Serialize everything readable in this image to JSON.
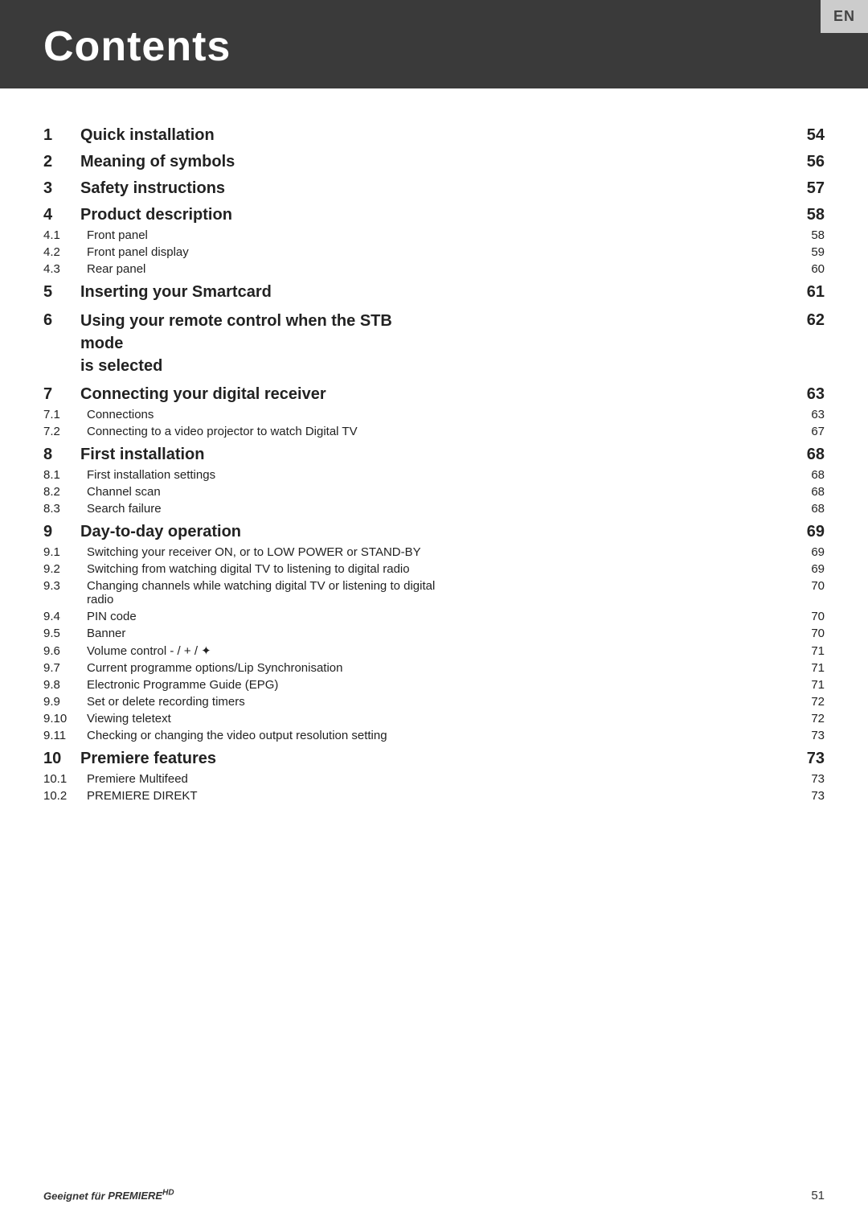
{
  "header": {
    "title": "Contents",
    "lang_tab": "EN"
  },
  "footer": {
    "brand_prefix": "Geeignet für",
    "brand_name": "PREMIEREHD",
    "page_number": "51"
  },
  "toc": {
    "entries": [
      {
        "id": "1",
        "number": "1",
        "label": "Quick installation",
        "page": "54",
        "level": "major"
      },
      {
        "id": "2",
        "number": "2",
        "label": "Meaning of symbols",
        "page": "56",
        "level": "major"
      },
      {
        "id": "3",
        "number": "3",
        "label": "Safety instructions",
        "page": "57",
        "level": "major"
      },
      {
        "id": "4",
        "number": "4",
        "label": "Product description",
        "page": "58",
        "level": "major"
      },
      {
        "id": "4.1",
        "number": "4.1",
        "label": "Front panel",
        "page": "58",
        "level": "minor"
      },
      {
        "id": "4.2",
        "number": "4.2",
        "label": "Front panel display",
        "page": "59",
        "level": "minor"
      },
      {
        "id": "4.3",
        "number": "4.3",
        "label": "Rear panel",
        "page": "60",
        "level": "minor"
      },
      {
        "id": "5",
        "number": "5",
        "label": "Inserting your Smartcard",
        "page": "61",
        "level": "major"
      },
      {
        "id": "6",
        "number": "6",
        "label": "Using your remote control when the STB mode is selected",
        "page": "62",
        "level": "major",
        "multiline": true
      },
      {
        "id": "7",
        "number": "7",
        "label": "Connecting your digital receiver",
        "page": "63",
        "level": "major"
      },
      {
        "id": "7.1",
        "number": "7.1",
        "label": "Connections",
        "page": "63",
        "level": "minor"
      },
      {
        "id": "7.2",
        "number": "7.2",
        "label": "Connecting to a video projector to watch Digital TV",
        "page": "67",
        "level": "minor"
      },
      {
        "id": "8",
        "number": "8",
        "label": "First installation",
        "page": "68",
        "level": "major"
      },
      {
        "id": "8.1",
        "number": "8.1",
        "label": "First installation settings",
        "page": "68",
        "level": "minor"
      },
      {
        "id": "8.2",
        "number": "8.2",
        "label": "Channel scan",
        "page": "68",
        "level": "minor"
      },
      {
        "id": "8.3",
        "number": "8.3",
        "label": "Search failure",
        "page": "68",
        "level": "minor"
      },
      {
        "id": "9",
        "number": "9",
        "label": "Day-to-day operation",
        "page": "69",
        "level": "major"
      },
      {
        "id": "9.1",
        "number": "9.1",
        "label": "Switching your receiver ON, or to LOW POWER or STAND-BY",
        "page": "69",
        "level": "minor"
      },
      {
        "id": "9.2",
        "number": "9.2",
        "label": "Switching from watching digital TV to listening to digital radio",
        "page": "69",
        "level": "minor"
      },
      {
        "id": "9.3",
        "number": "9.3",
        "label": "Changing channels while watching digital TV or listening to digital radio",
        "page": "70",
        "level": "minor"
      },
      {
        "id": "9.4",
        "number": "9.4",
        "label": "PIN code",
        "page": "70",
        "level": "minor"
      },
      {
        "id": "9.5",
        "number": "9.5",
        "label": "Banner",
        "page": "70",
        "level": "minor"
      },
      {
        "id": "9.6",
        "number": "9.6",
        "label": "Volume control  - /  + / ❖",
        "page": "71",
        "level": "minor"
      },
      {
        "id": "9.7",
        "number": "9.7",
        "label": "Current programme options/Lip Synchronisation",
        "page": "71",
        "level": "minor"
      },
      {
        "id": "9.8",
        "number": "9.8",
        "label": "Electronic Programme Guide (EPG)",
        "page": "71",
        "level": "minor"
      },
      {
        "id": "9.9",
        "number": "9.9",
        "label": "Set or delete recording timers",
        "page": "72",
        "level": "minor"
      },
      {
        "id": "9.10",
        "number": "9.10",
        "label": "Viewing teletext",
        "page": "72",
        "level": "minor"
      },
      {
        "id": "9.11",
        "number": "9.11",
        "label": "Checking or changing the video output resolution setting",
        "page": "73",
        "level": "minor"
      },
      {
        "id": "10",
        "number": "10",
        "label": "Premiere features",
        "page": "73",
        "level": "major"
      },
      {
        "id": "10.1",
        "number": "10.1",
        "label": "Premiere Multifeed",
        "page": "73",
        "level": "minor"
      },
      {
        "id": "10.2",
        "number": "10.2",
        "label": "PREMIERE DIREKT",
        "page": "73",
        "level": "minor"
      }
    ]
  }
}
